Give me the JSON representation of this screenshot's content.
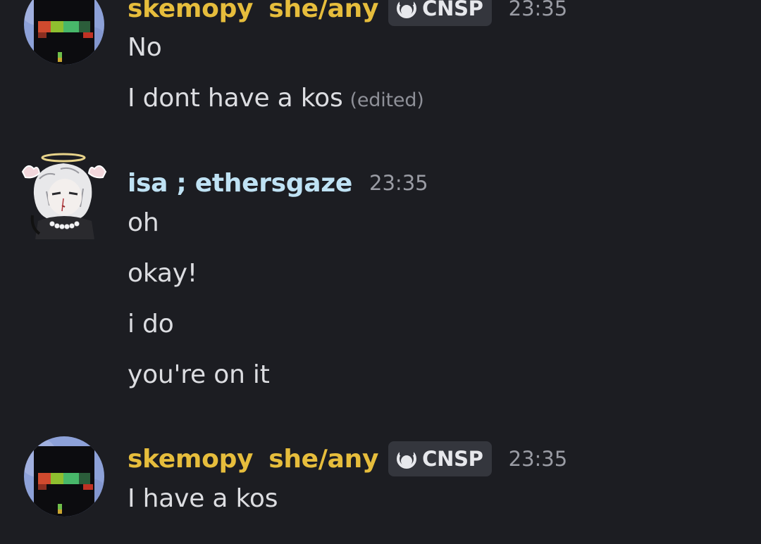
{
  "messages": [
    {
      "author": "skemopy",
      "pronouns": "she/any",
      "tag": "CNSP",
      "time": "23:35",
      "lines": [
        "No",
        "I dont have a kos"
      ],
      "edited_label": "(edited)"
    },
    {
      "author": "isa ; ethersgaze",
      "time": "23:35",
      "lines": [
        "oh",
        "okay!",
        "i do",
        "you're on it"
      ]
    },
    {
      "author": "skemopy",
      "pronouns": "she/any",
      "tag": "CNSP",
      "time": "23:35",
      "lines": [
        "I have a kos"
      ]
    }
  ],
  "colors": {
    "background": "#1c1d22",
    "username_gold": "#e6bd3c",
    "username_blue": "#bfe2f4",
    "message_text": "#dcdde1",
    "timestamp": "#9a9ca4",
    "tag_background": "#34363d"
  },
  "icons": {
    "tag_icon": "crescent-ring-icon",
    "avatar_skemopy": "pixel-character-avatar",
    "avatar_isa": "angel-drawing-avatar"
  }
}
